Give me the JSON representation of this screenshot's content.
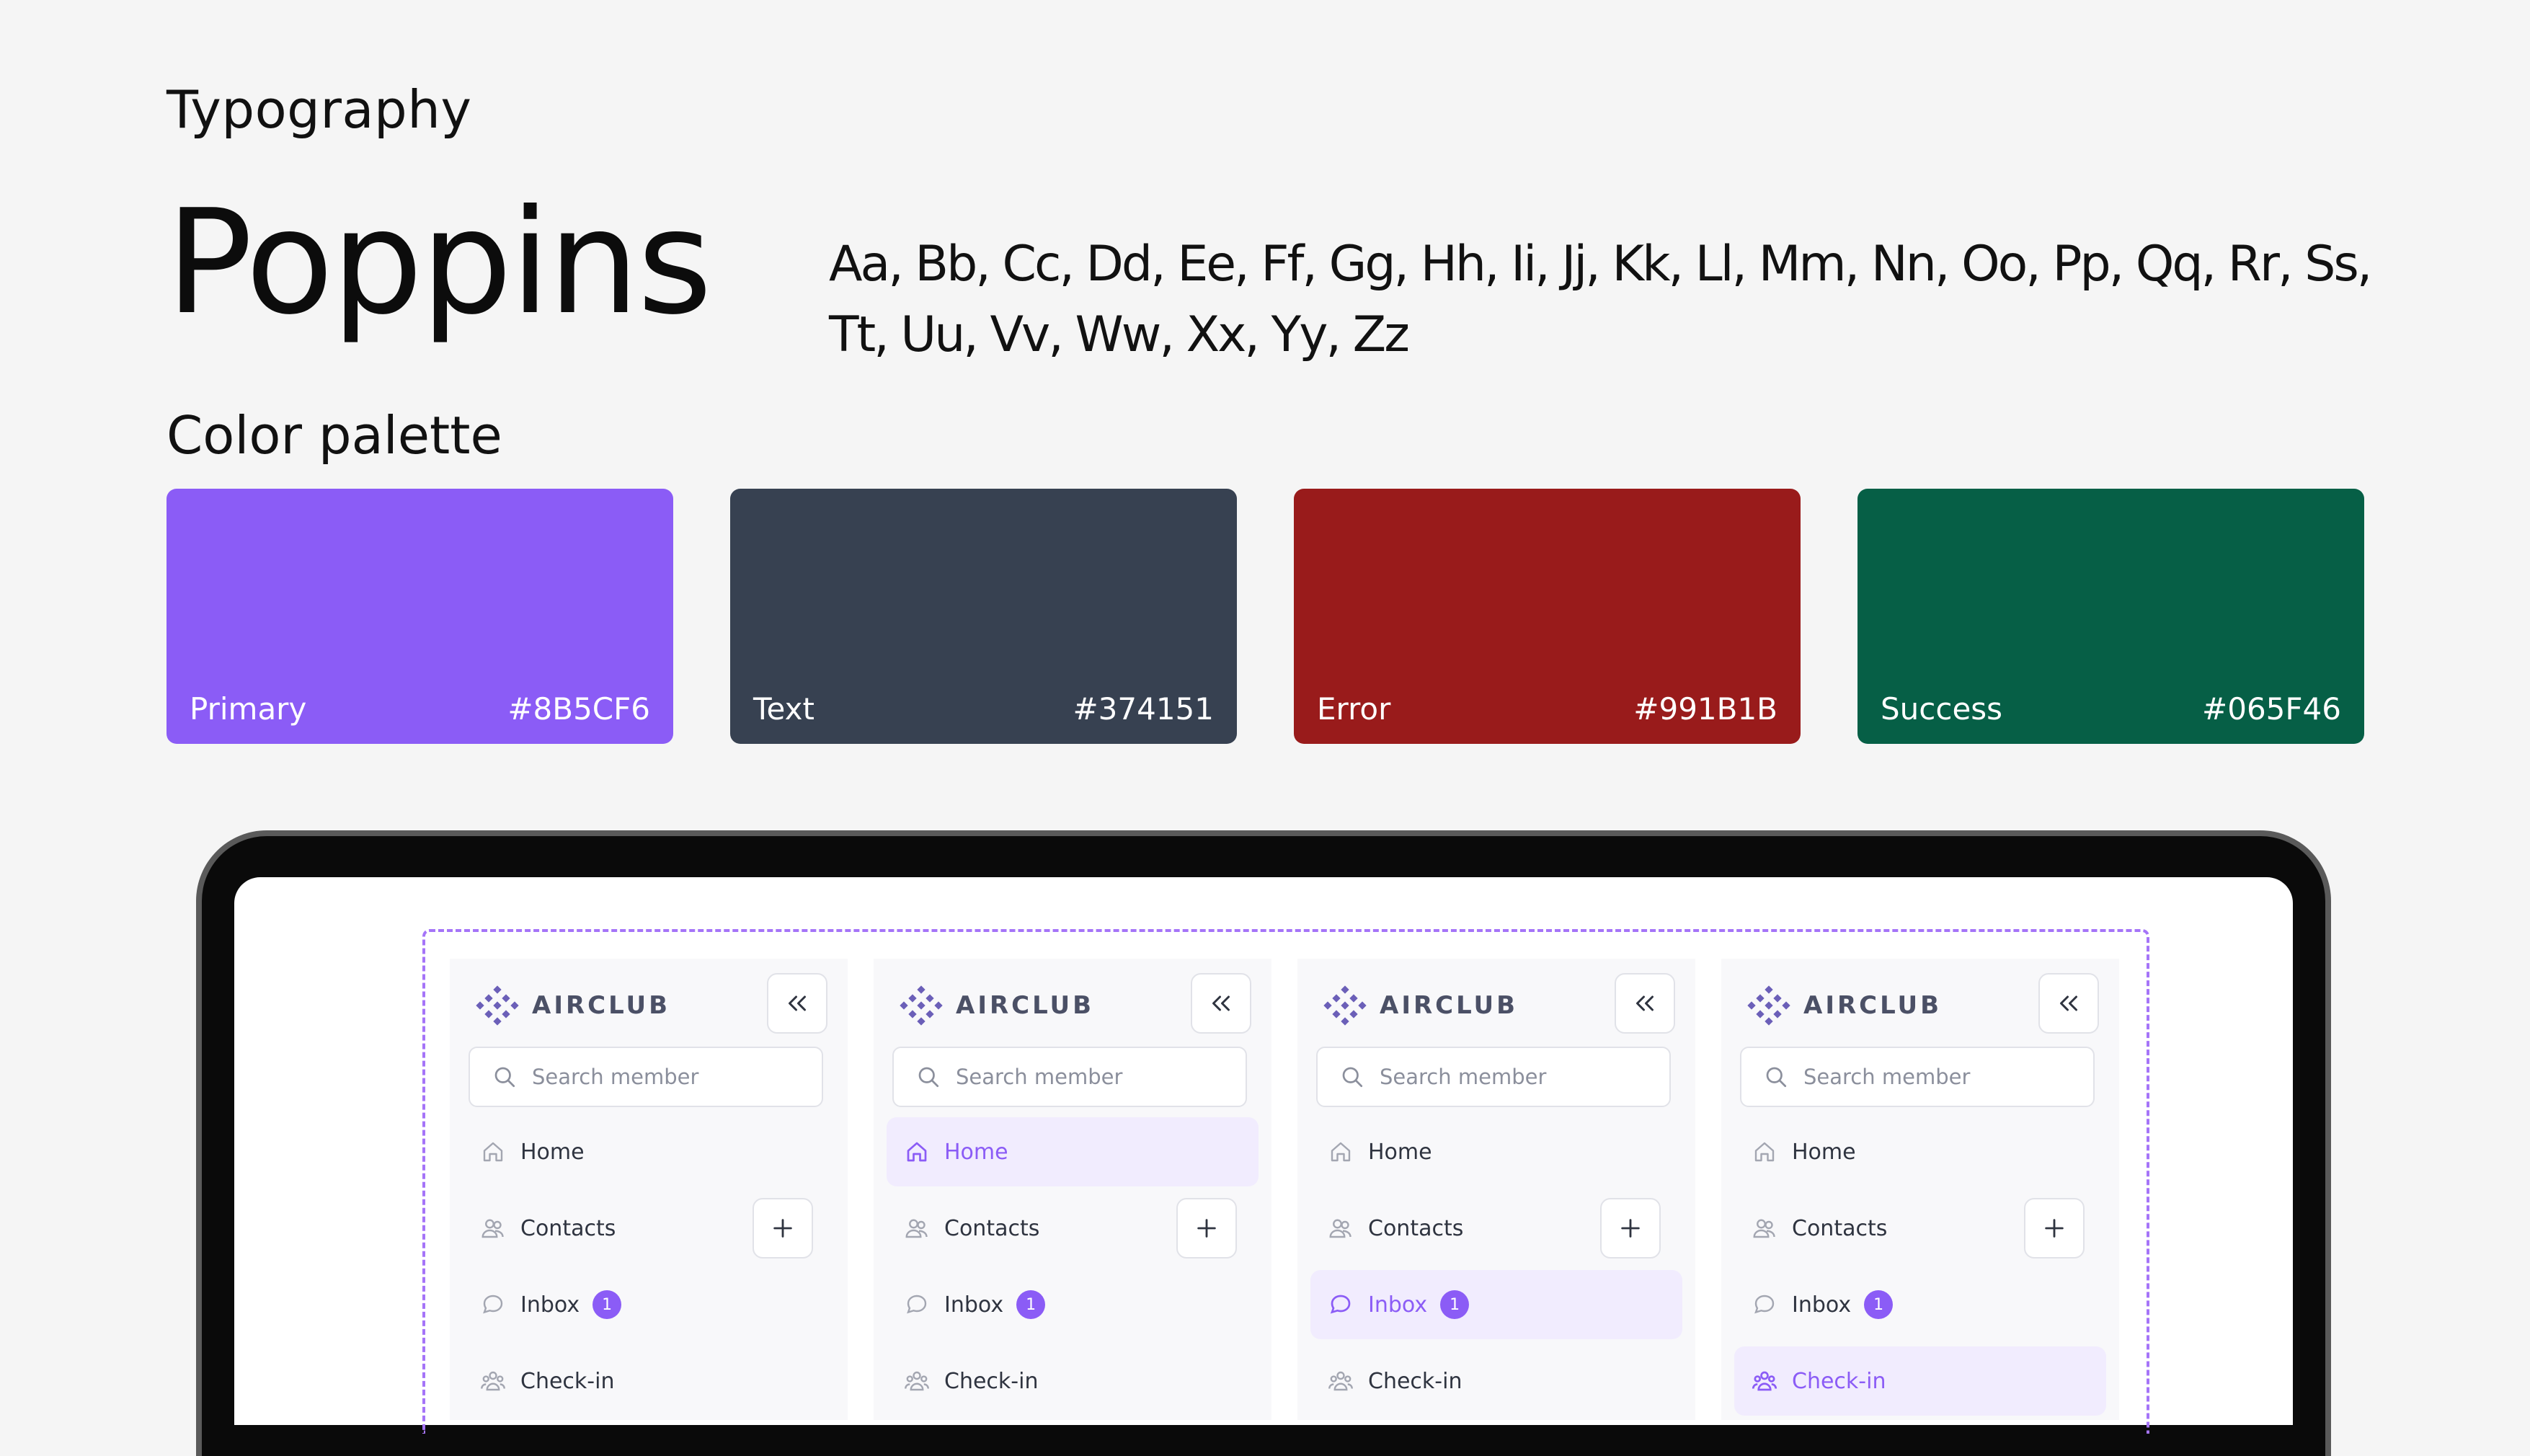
{
  "typography": {
    "heading": "Typography",
    "font_name": "Poppins",
    "alphabet": "Aa, Bb, Cc, Dd, Ee, Ff, Gg, Hh, Ii, Jj, Kk, Ll, Mm, Nn, Oo, Pp,  Qq, Rr, Ss, Tt, Uu, Vv, Ww, Xx, Yy, Zz"
  },
  "palette": {
    "heading": "Color palette",
    "swatches": [
      {
        "name": "Primary",
        "hex": "#8B5CF6",
        "color": "#8b5cf6"
      },
      {
        "name": "Text",
        "hex": "#374151",
        "color": "#374151"
      },
      {
        "name": "Error",
        "hex": "#991B1B",
        "color": "#991b1b"
      },
      {
        "name": "Success",
        "hex": "#065F46",
        "color": "#065f46"
      }
    ]
  },
  "sidebar_variants": [
    {
      "brand": "AIRCLUB",
      "search_placeholder": "Search member",
      "active": "home-none",
      "nav": {
        "home": "Home",
        "contacts": "Contacts",
        "inbox": "Inbox",
        "inbox_badge": "1",
        "checkin": "Check-in"
      }
    },
    {
      "brand": "AIRCLUB",
      "search_placeholder": "Search member",
      "active": "home",
      "nav": {
        "home": "Home",
        "contacts": "Contacts",
        "inbox": "Inbox",
        "inbox_badge": "1",
        "checkin": "Check-in"
      }
    },
    {
      "brand": "AIRCLUB",
      "search_placeholder": "Search member",
      "active": "inbox",
      "nav": {
        "home": "Home",
        "contacts": "Contacts",
        "inbox": "Inbox",
        "inbox_badge": "1",
        "checkin": "Check-in"
      }
    },
    {
      "brand": "AIRCLUB",
      "search_placeholder": "Search member",
      "active": "checkin",
      "nav": {
        "home": "Home",
        "contacts": "Contacts",
        "inbox": "Inbox",
        "inbox_badge": "1",
        "checkin": "Check-in"
      }
    }
  ],
  "icons": {
    "logo": "airclub-logo-icon",
    "collapse": "double-chevron-left-icon",
    "search": "search-icon",
    "home": "home-icon",
    "contacts": "users-icon",
    "inbox": "chat-bubble-icon",
    "checkin": "group-icon",
    "add": "plus-icon"
  },
  "colors": {
    "accent": "#8b5cf6",
    "active_bg": "#f1ecfe",
    "nav_text": "#2f3440"
  }
}
